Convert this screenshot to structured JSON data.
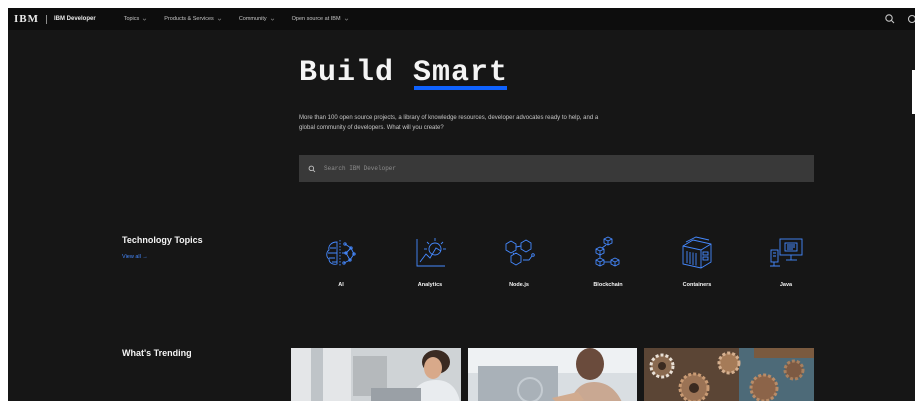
{
  "nav": {
    "logo": "IBM",
    "brand": "IBM Developer",
    "items": [
      {
        "label": "Topics"
      },
      {
        "label": "Products & Services"
      },
      {
        "label": "Community"
      },
      {
        "label": "Open source at IBM"
      }
    ],
    "search_icon": "search-icon",
    "user_icon": "user-icon"
  },
  "hero": {
    "title_part1": "Build ",
    "title_highlight": "Smart",
    "subtitle": "More than 100 open source projects, a library of knowledge resources, developer advocates ready to help, and a global community of developers. What will you create?",
    "search_placeholder": "Search IBM Developer"
  },
  "technology_topics": {
    "heading": "Technology Topics",
    "view_all": "View all →",
    "topics": [
      {
        "label": "AI",
        "icon": "ai-brain-icon"
      },
      {
        "label": "Analytics",
        "icon": "analytics-chart-icon"
      },
      {
        "label": "Node.js",
        "icon": "nodejs-hexagon-icon"
      },
      {
        "label": "Blockchain",
        "icon": "blockchain-cubes-icon"
      },
      {
        "label": "Containers",
        "icon": "containers-box-icon"
      },
      {
        "label": "Java",
        "icon": "java-monitor-icon"
      }
    ]
  },
  "trending": {
    "heading": "What's Trending",
    "cards": [
      {
        "image": "woman-at-laptop-photo"
      },
      {
        "image": "hands-on-laptop-photo"
      },
      {
        "image": "rusty-gears-photo"
      }
    ]
  },
  "colors": {
    "background": "#161616",
    "nav_background": "#0d0d0d",
    "accent": "#0f62fe",
    "link": "#4589ff",
    "icon": "#4589ff",
    "search_field": "#393939"
  }
}
